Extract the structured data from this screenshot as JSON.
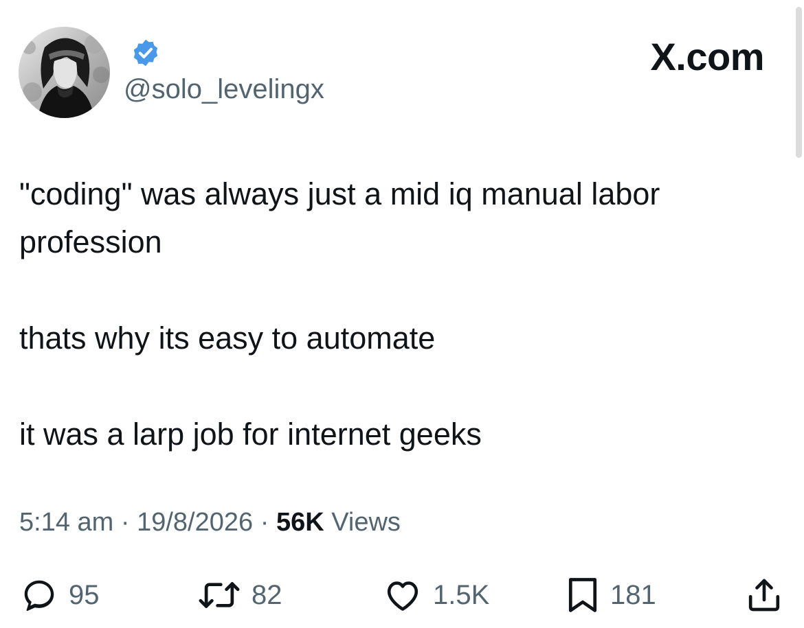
{
  "header": {
    "handle": "@solo_levelingx",
    "brand": "X.com",
    "verified_color": "#4a99e9"
  },
  "tweet": {
    "line1": "\"coding\" was always just a mid iq manual labor profession",
    "line2": "thats why its easy to automate",
    "line3": "it was a larp job for internet geeks"
  },
  "meta": {
    "time": "5:14 am",
    "date": "19/8/2026",
    "sep": "·",
    "views_count": "56K",
    "views_label": "Views"
  },
  "actions": {
    "replies": "95",
    "reposts": "82",
    "likes": "1.5K",
    "bookmarks": "181"
  },
  "icons": [
    "avatar",
    "verified-icon",
    "reply-icon",
    "repost-icon",
    "like-icon",
    "bookmark-icon",
    "share-icon"
  ]
}
